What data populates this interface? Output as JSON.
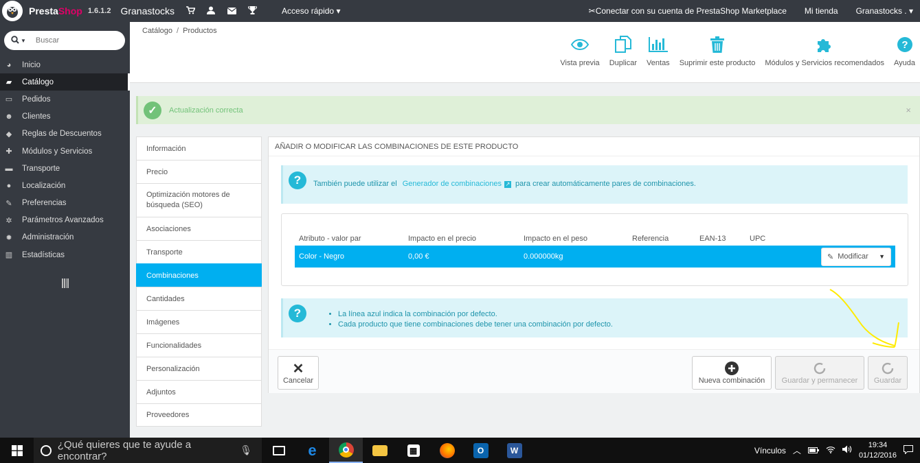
{
  "topbar": {
    "brand_part1": "Presta",
    "brand_part2": "Shop",
    "version": "1.6.1.2",
    "shop_name": "Granastocks",
    "quick_access": "Acceso rápido",
    "marketplace_link": "Conectar con su cuenta de PrestaShop Marketplace",
    "my_shop": "Mi tienda",
    "user": "Granastocks ."
  },
  "search": {
    "placeholder": "Buscar"
  },
  "sidebar": {
    "items": [
      {
        "label": "Inicio",
        "icon": "dashboard-icon"
      },
      {
        "label": "Catálogo",
        "icon": "book-icon"
      },
      {
        "label": "Pedidos",
        "icon": "credit-card-icon"
      },
      {
        "label": "Clientes",
        "icon": "users-icon"
      },
      {
        "label": "Reglas de Descuentos",
        "icon": "tags-icon"
      },
      {
        "label": "Módulos y Servicios",
        "icon": "puzzle-icon"
      },
      {
        "label": "Transporte",
        "icon": "truck-icon"
      },
      {
        "label": "Localización",
        "icon": "globe-icon"
      },
      {
        "label": "Preferencias",
        "icon": "wrench-icon"
      },
      {
        "label": "Parámetros Avanzados",
        "icon": "cogs-icon"
      },
      {
        "label": "Administración",
        "icon": "cog-icon"
      },
      {
        "label": "Estadísticas",
        "icon": "bar-chart-icon"
      }
    ],
    "active_index": 1
  },
  "breadcrumb": {
    "level1": "Catálogo",
    "separator": "/",
    "level2": "Productos"
  },
  "toolbar": {
    "buttons": [
      {
        "label": "Vista previa",
        "icon": "eye-icon"
      },
      {
        "label": "Duplicar",
        "icon": "copy-icon"
      },
      {
        "label": "Ventas",
        "icon": "bar-chart-icon"
      },
      {
        "label": "Suprimir este producto",
        "icon": "trash-icon"
      },
      {
        "label": "Módulos y Servicios recomendados",
        "icon": "puzzle-icon"
      },
      {
        "label": "Ayuda",
        "icon": "help-icon"
      }
    ]
  },
  "alert": {
    "text": "Actualización correcta",
    "close": "×"
  },
  "tabs": [
    "Información",
    "Precio",
    "Optimización motores de búsqueda (SEO)",
    "Asociaciones",
    "Transporte",
    "Combinaciones",
    "Cantidades",
    "Imágenes",
    "Funcionalidades",
    "Personalización",
    "Adjuntos",
    "Proveedores"
  ],
  "active_tab_index": 5,
  "panel": {
    "title": "Añadir o modificar las combinaciones de este producto",
    "info1": {
      "before": "También puede utilizar el",
      "link": "Generador de combinaciones",
      "after": "para crear automáticamente pares de combinaciones."
    },
    "table": {
      "headers": [
        "Atributo - valor par",
        "Impacto en el precio",
        "Impacto en el peso",
        "Referencia",
        "EAN-13",
        "UPC"
      ],
      "rows": [
        {
          "attribute": "Color - Negro",
          "price_impact": "0,00 €",
          "weight_impact": "0.000000kg",
          "reference": "",
          "ean13": "",
          "upc": "",
          "action": "Modificar"
        }
      ]
    },
    "info2": {
      "bullets": [
        "La línea azul indica la combinación por defecto.",
        "Cada producto que tiene combinaciones debe tener una combinación por defecto."
      ]
    },
    "footer": {
      "cancel": "Cancelar",
      "new_combination": "Nueva combinación",
      "save_and_stay": "Guardar y permanecer",
      "save": "Guardar"
    }
  },
  "colors": {
    "accent": "#00aff0",
    "sidebar": "#363a41",
    "success": "#72c279",
    "annotation": "#ffeb00"
  },
  "taskbar": {
    "search_placeholder": "¿Qué quieres que te ayude a encontrar?",
    "links_label": "Vínculos",
    "time": "19:34",
    "date": "01/12/2016"
  }
}
